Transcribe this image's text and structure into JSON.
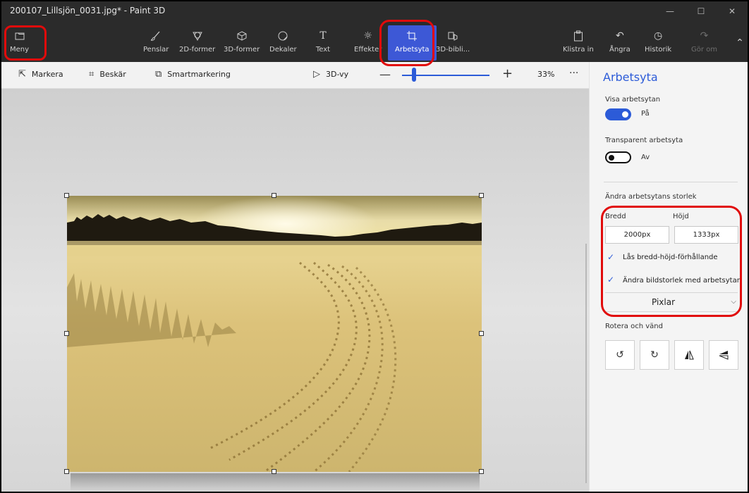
{
  "window": {
    "title": "200107_Lillsjön_0031.jpg* - Paint 3D",
    "controls": {
      "minimize": "—",
      "maximize": "☐",
      "close": "✕"
    }
  },
  "ribbon": {
    "menu": "Meny",
    "brushes": "Penslar",
    "shapes2d": "2D-former",
    "shapes3d": "3D-former",
    "stickers": "Dekaler",
    "text": "Text",
    "effects": "Effekter",
    "canvas": "Arbetsyta",
    "library": "3D-bibli...",
    "paste": "Klistra in",
    "undo": "Ångra",
    "history": "Historik",
    "redo": "Gör om"
  },
  "toolbar": {
    "select": "Markera",
    "crop": "Beskär",
    "magic_select": "Smartmarkering",
    "view3d": "3D-vy",
    "zoom": "33%",
    "more": "···"
  },
  "panel": {
    "title": "Arbetsyta",
    "show_canvas_label": "Visa arbetsytan",
    "show_canvas_state": "På",
    "transparent_label": "Transparent arbetsyta",
    "transparent_state": "Av",
    "resize_label": "Ändra arbetsytans storlek",
    "width_label": "Bredd",
    "height_label": "Höjd",
    "width_value": "2000px",
    "height_value": "1333px",
    "lock_ratio": "Lås bredd-höjd-förhållande",
    "resize_image": "Ändra bildstorlek med arbetsytan",
    "units": "Pixlar",
    "rotate_label": "Rotera och vänd"
  },
  "colors": {
    "accent": "#2c5bd8",
    "ribbon_bg": "#2b2b2b",
    "highlight": "#e10b0b"
  }
}
